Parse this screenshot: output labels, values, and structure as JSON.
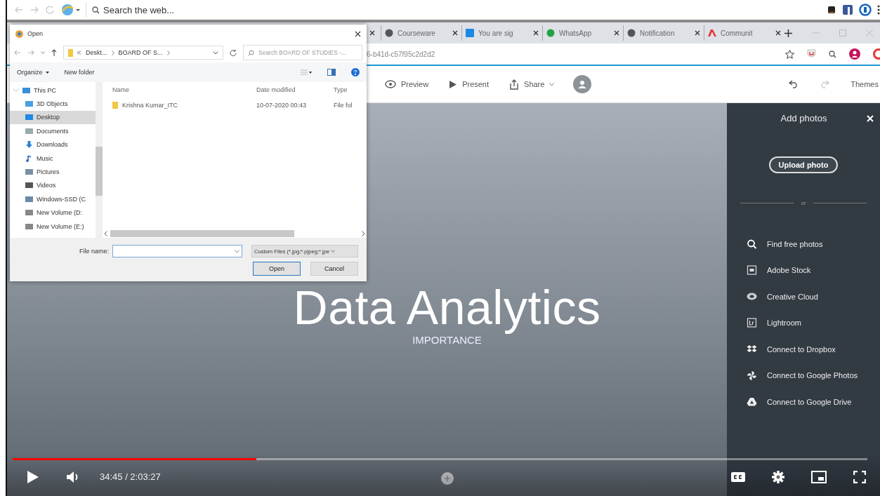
{
  "browser": {
    "search": {
      "placeholder": "Search the web..."
    },
    "tabs": [
      {
        "label": "Courseware",
        "selected": false
      },
      {
        "label": "You are sig",
        "selected": false
      },
      {
        "label": "WhatsApp",
        "selected": false
      },
      {
        "label": "Notification",
        "selected": false
      },
      {
        "label": "Communit",
        "selected": false
      }
    ],
    "address": {
      "value": "6-b41d-c57f95c2d2d2"
    }
  },
  "app_toolbar": {
    "actions": [
      {
        "label": "Preview",
        "kind": "preview"
      },
      {
        "label": "Present",
        "kind": "present"
      },
      {
        "label": "Share",
        "kind": "share"
      }
    ],
    "themes": "Themes"
  },
  "slide": {
    "title": "Data Analytics",
    "subtitle": "IMPORTANCE"
  },
  "photos_panel": {
    "title": "Add photos",
    "upload_button": "Upload photo",
    "separator": "or",
    "sources": [
      {
        "label": "Find free photos",
        "kind": "search"
      },
      {
        "label": "Adobe Stock",
        "kind": "stock"
      },
      {
        "label": "Creative Cloud",
        "kind": "cloud"
      },
      {
        "label": "Lightroom",
        "kind": "lightroom"
      },
      {
        "label": "Connect to Dropbox",
        "kind": "dropbox"
      },
      {
        "label": "Connect to Google Photos",
        "kind": "photos"
      },
      {
        "label": "Connect to Google Drive",
        "kind": "drive"
      }
    ]
  },
  "open_dialog": {
    "title": "Open",
    "breadcrumb": [
      "Deskt...",
      "BOARD OF S..."
    ],
    "search": {
      "placeholder": "Search BOARD OF STUDIES -..."
    },
    "toolbar": [
      "Organize",
      "New folder"
    ],
    "tree": [
      {
        "label": "This PC",
        "kind": "pc",
        "expanded": true,
        "selected": false,
        "children": [
          {
            "label": "3D Objects",
            "kind": "objects",
            "selected": false
          },
          {
            "label": "Desktop",
            "kind": "desktop",
            "selected": true
          },
          {
            "label": "Documents",
            "kind": "documents",
            "selected": false
          },
          {
            "label": "Downloads",
            "kind": "downloads",
            "selected": false
          },
          {
            "label": "Music",
            "kind": "music",
            "selected": false
          },
          {
            "label": "Pictures",
            "kind": "pictures",
            "selected": false
          },
          {
            "label": "Videos",
            "kind": "videos",
            "selected": false
          },
          {
            "label": "Windows-SSD (C",
            "kind": "drive",
            "selected": false
          },
          {
            "label": "New Volume (D:",
            "kind": "volume",
            "selected": false
          },
          {
            "label": "New Volume (E:)",
            "kind": "volume",
            "selected": false
          }
        ]
      }
    ],
    "columns": [
      "Name",
      "Date modified",
      "Type"
    ],
    "rows": [
      {
        "cells": [
          "Krishna Kumar_ITC",
          "10-07-2020 00:43",
          "File fol"
        ]
      }
    ],
    "file_name_label": "File name:",
    "filter": "Custom Files (*.jpg;*.pjpeg;*.jpe",
    "buttons": [
      "Open",
      "Cancel"
    ]
  },
  "player": {
    "level": 0.285,
    "time": "34:45 / 2:03:27"
  }
}
